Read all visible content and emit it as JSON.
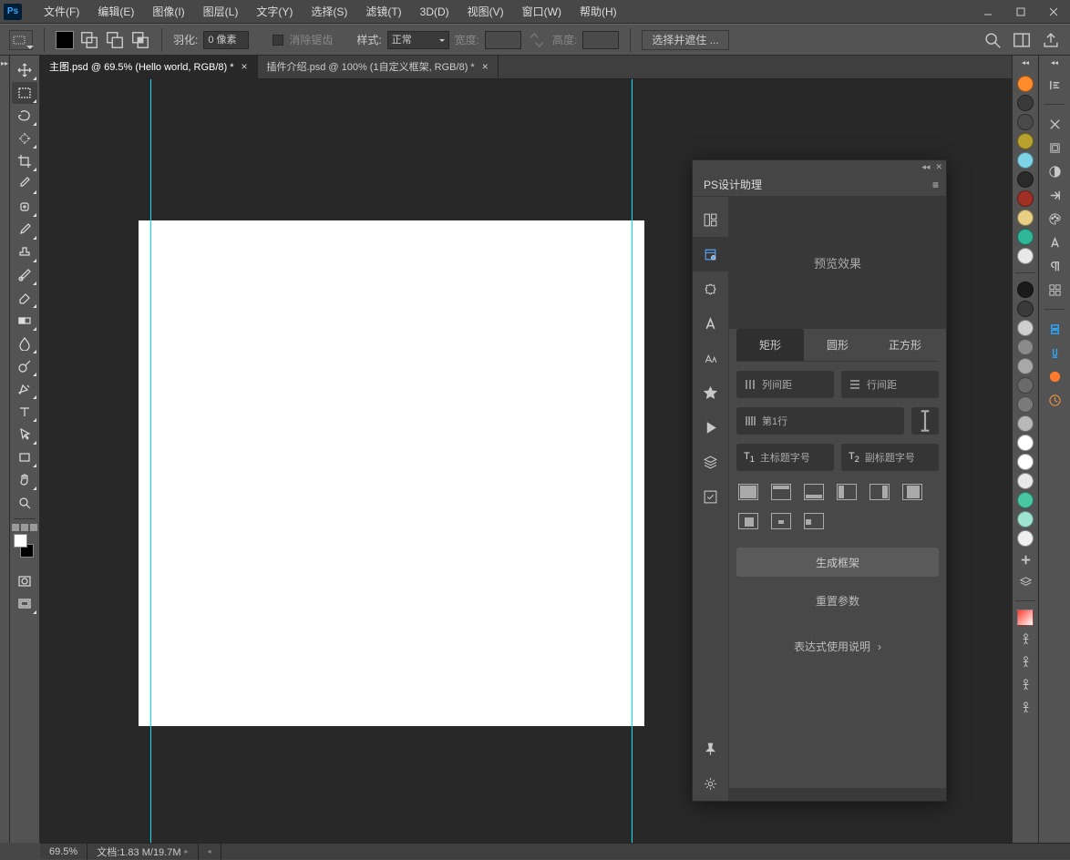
{
  "app": {
    "logo": "Ps"
  },
  "menu": [
    "文件(F)",
    "编辑(E)",
    "图像(I)",
    "图层(L)",
    "文字(Y)",
    "选择(S)",
    "滤镜(T)",
    "3D(D)",
    "视图(V)",
    "窗口(W)",
    "帮助(H)"
  ],
  "options": {
    "feather_label": "羽化:",
    "feather_value": "0 像素",
    "antialias": "消除锯齿",
    "style_label": "样式:",
    "style_value": "正常",
    "width_label": "宽度:",
    "height_label": "高度:",
    "mask_btn": "选择并遮住 ..."
  },
  "tabs": [
    {
      "label": "主图.psd @ 69.5% (Hello world, RGB/8) *"
    },
    {
      "label": "插件介绍.psd @ 100% (1自定义框架, RGB/8) *"
    }
  ],
  "panel": {
    "title": "PS设计助理",
    "preview": "预览效果",
    "shape_tabs": [
      "矩形",
      "圆形",
      "正方形"
    ],
    "col_gap": "列间距",
    "row_gap": "行间距",
    "first_row": "第1行",
    "t1": "主标题字号",
    "t2": "副标题字号",
    "generate": "生成框架",
    "reset": "重置参数",
    "help": "表达式使用说明"
  },
  "status": {
    "zoom": "69.5%",
    "doc": "文档:1.83 M/19.7M"
  },
  "swatches1": [
    "#ff8a2b",
    "#3a3a3a",
    "#4a4a4a",
    "#b9a12e",
    "#7ed4e6",
    "#2a2a2a",
    "#a03024",
    "#e8cf84",
    "#2fb79a",
    "#e8e8e8"
  ],
  "swatches2": [
    "#1a1a1a",
    "#3a3a3a",
    "#cfcfcf",
    "#8a8a8a",
    "#a8a8a8",
    "#6a6a6a",
    "#7a7a7a",
    "#b8b8b8",
    "#ffffff",
    "#ffffff",
    "#e8e8e8",
    "#49c7a5",
    "#9fe4d2",
    "#efefef"
  ],
  "gradient_strip": "linear-gradient(135deg,#ff3b30,#ffffff)"
}
